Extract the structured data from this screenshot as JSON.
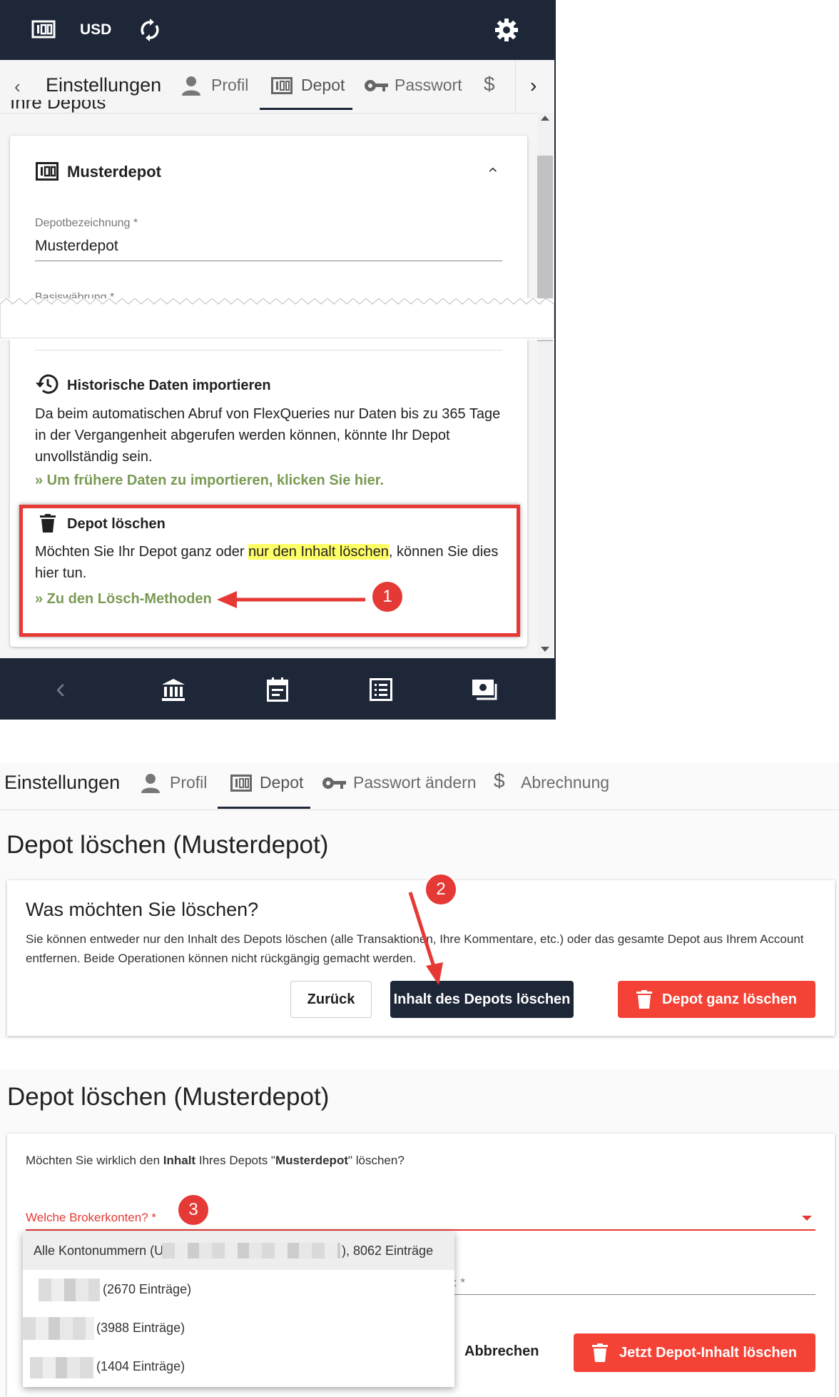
{
  "colors": {
    "dark": "#1e2738",
    "accent_green": "#7a9a54",
    "danger": "#f44336",
    "highlight": "#ffff66",
    "annotation": "#e53935"
  },
  "panel1": {
    "topbar": {
      "currency": "USD",
      "icons": [
        "depot-icon",
        "refresh-icon",
        "gear-icon"
      ]
    },
    "tabs": {
      "title": "Einstellungen",
      "items": [
        "Profil",
        "Depot",
        "Passwort",
        "$"
      ],
      "active": "Depot"
    },
    "section_heading_partial": "Ihre Depots",
    "card": {
      "title": "Musterdepot",
      "field_label": "Depotbezeichnung *",
      "field_value": "Musterdepot",
      "cut_label": "Basiswährung *",
      "historic": {
        "title": "Historische Daten importieren",
        "text": "Da beim automatischen Abruf von FlexQueries nur Daten bis zu 365 Tage in der Vergangenheit abgerufen werden können, könnte Ihr Depot unvollständig sein.",
        "link": "» Um frühere Daten zu importieren, klicken Sie hier."
      },
      "delete": {
        "title": "Depot löschen",
        "text_before": "Möchten Sie Ihr Depot ganz oder ",
        "text_highlight": "nur den Inhalt löschen",
        "text_after": ", können Sie dies hier tun.",
        "link": "» Zu den Lösch-Methoden"
      }
    },
    "bottom_nav": [
      "back-icon",
      "bank-icon",
      "calendar-icon",
      "list-icon",
      "money-icon"
    ],
    "annotation": "1"
  },
  "panel2": {
    "tabs": {
      "title": "Einstellungen",
      "items": [
        "Profil",
        "Depot",
        "Passwort ändern",
        "Abrechnung"
      ],
      "active": "Depot"
    },
    "heading": "Depot löschen (Musterdepot)",
    "card": {
      "question": "Was möchten Sie löschen?",
      "text": "Sie können entweder nur den Inhalt des Depots löschen (alle Transaktionen, Ihre Kommentare, etc.) oder das gesamte Depot aus Ihrem Account entfernen. Beide Operationen können nicht rückgängig gemacht werden.",
      "btn_back": "Zurück",
      "btn_content": "Inhalt des Depots löschen",
      "btn_all": "Depot ganz löschen"
    },
    "annotation": "2"
  },
  "panel3": {
    "heading": "Depot löschen (Musterdepot)",
    "q_1": "Möchten Sie wirklich den ",
    "q_2": "Inhalt",
    "q_3": " Ihres Depots \"",
    "q_4": "Musterdepot",
    "q_5": "\" löschen?",
    "select_label": "Welche Brokerkonten? *",
    "second_label_partial": "en: *",
    "dropdown": [
      {
        "prefix": "Alle Kontonummern (U",
        "suffix": "), 8062 Einträge"
      },
      {
        "suffix": "(2670 Einträge)"
      },
      {
        "suffix": "(3988 Einträge)"
      },
      {
        "suffix": "(1404 Einträge)"
      }
    ],
    "btn_cancel": "Abbrechen",
    "btn_delete": "Jetzt Depot-Inhalt löschen",
    "annotation": "3"
  }
}
